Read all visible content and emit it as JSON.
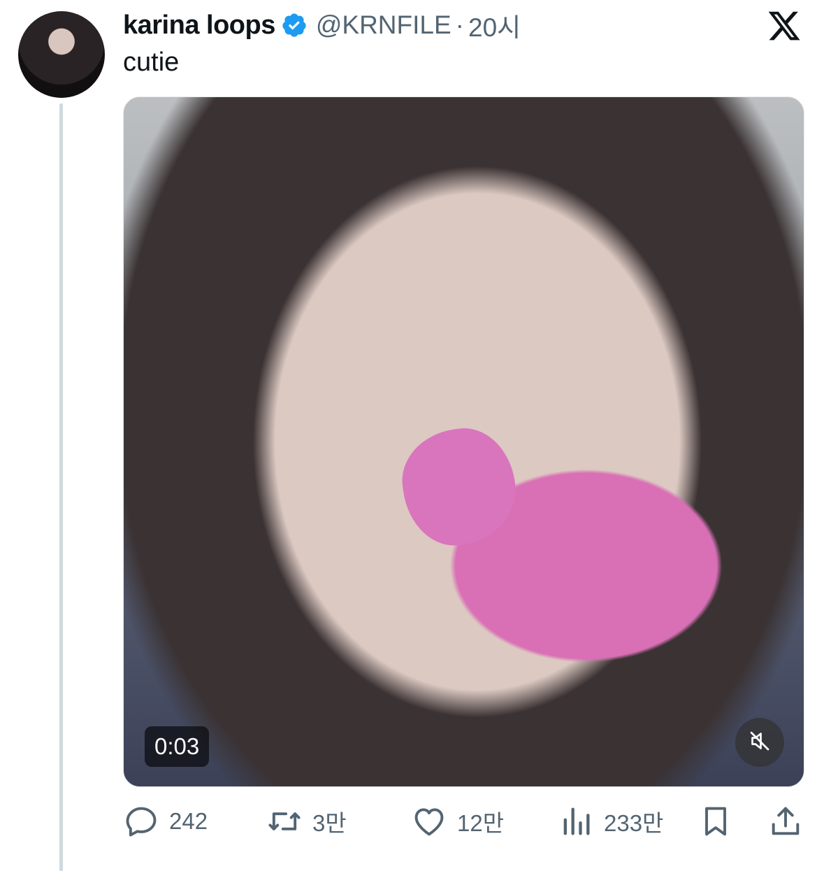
{
  "tweet": {
    "author_name": "karina loops",
    "handle": "@KRNFILE",
    "separator": "·",
    "time": "20시",
    "text": "cutie"
  },
  "media": {
    "duration": "0:03",
    "muted": true
  },
  "actions": {
    "replies": "242",
    "retweets": "3만",
    "likes": "12만",
    "views": "233만"
  },
  "colors": {
    "verified": "#1d9bf0",
    "secondary_text": "#536471",
    "thread_line": "#cfd9de"
  }
}
